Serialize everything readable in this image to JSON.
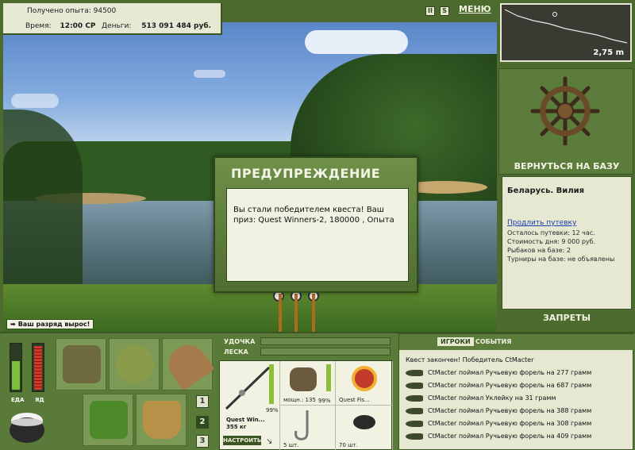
{
  "stats": {
    "exp_label": "Получено опыта:",
    "exp_value": "94500",
    "time_label": "Время:",
    "time_value": "12:00 СР",
    "money_label": "Деньги:",
    "money_value": "513 091 484 руб."
  },
  "topbar": {
    "pause_label": "II",
    "sound_label": "S",
    "menu_label": "МЕНЮ"
  },
  "minimap": {
    "depth": "2,75 m"
  },
  "base": {
    "return_label": "ВЕРНУТЬСЯ НА БАЗУ",
    "location": "Беларусь. Вилия",
    "extend_link": "Продлить путевку",
    "lines": [
      "Осталось путевки: 12 час.",
      "Стоимость дня: 9 000 руб.",
      "Рыбаков на базе: 2",
      "Турниры на базе: не объявлены"
    ],
    "bans_label": "ЗАПРЕТЫ"
  },
  "dialog": {
    "title": "ПРЕДУПРЕЖДЕНИЕ",
    "message": "Вы стали победителем квеста! Ваш приз: Quest Winners-2, 180000 , Опыта"
  },
  "rank_up": "Ваш разряд вырос!",
  "meters": {
    "food_label": "ЕДА",
    "poison_label": "ЯД",
    "food_level": 0.62,
    "poison_level": 0.95
  },
  "pages": [
    "1",
    "2",
    "3"
  ],
  "active_page": "2",
  "tackle": {
    "rod_label": "УДОЧКА",
    "line_label": "ЛЕСКА",
    "rod_name": "Quest Win...",
    "rod_weight": "355 кг",
    "rod_pct": "99%",
    "reel_label": "мощн.: 135",
    "reel_pct": "99%",
    "line_name": "Quest Fis...",
    "hook_count": "5 шт.",
    "bait_count": "70 шт.",
    "setup_label": "НАСТРОИТЬ"
  },
  "log": {
    "tab_players": "ИГРОКИ",
    "tab_events": "СОБЫТИЯ",
    "quest_line": "Квест закончен! Победитель CtMacter",
    "entries": [
      "CtMacter поймал Ручьевую форель на 277 грамм",
      "CtMacter поймал Ручьевую форель на 687 грамм",
      "CtMacter поймал Уклейку на 31 грамм",
      "CtMacter поймал Ручьевую форель на 388 грамм",
      "CtMacter поймал Ручьевую форель на 308 грамм",
      "CtMacter поймал Ручьевую форель на 409 грамм"
    ]
  },
  "colors": {
    "panel_green": "#597a38",
    "cream": "#e6e8d2",
    "dark_green": "#2f4a1b",
    "food_bar": "#7bbf3a",
    "poison_bar": "#d23a2a"
  }
}
